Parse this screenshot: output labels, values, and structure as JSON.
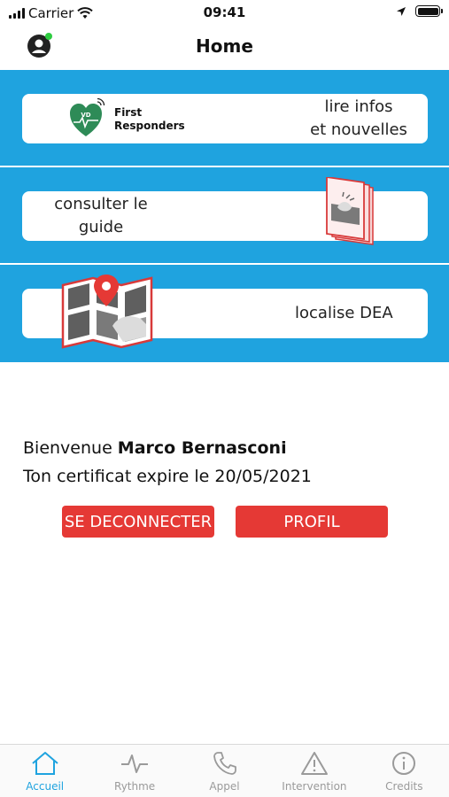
{
  "status_bar": {
    "carrier": "Carrier",
    "time": "09:41"
  },
  "nav": {
    "title": "Home"
  },
  "menu": {
    "news": {
      "logo_badge": "VD",
      "logo_line1": "First",
      "logo_line2": "Responders",
      "label_line1": "lire infos",
      "label_line2": "et nouvelles"
    },
    "guide": {
      "label_line1": "consulter le",
      "label_line2": "guide"
    },
    "dea": {
      "label": "localise DEA"
    }
  },
  "welcome": {
    "prefix": "Bienvenue ",
    "name": "Marco Bernasconi",
    "certificate": "Ton certificat expire le 20/05/2021"
  },
  "buttons": {
    "logout": "SE DECONNECTER",
    "profile": "PROFIL"
  },
  "tabs": [
    {
      "label": "Accueil",
      "icon": "home-icon",
      "active": true
    },
    {
      "label": "Rythme",
      "icon": "pulse-icon"
    },
    {
      "label": "Appel",
      "icon": "phone-icon"
    },
    {
      "label": "Intervention",
      "icon": "warning-icon"
    },
    {
      "label": "Credits",
      "icon": "info-icon"
    }
  ],
  "colors": {
    "accent": "#1fa3df",
    "button": "#e53935",
    "logo_green": "#2e8b57",
    "online": "#2ecc40"
  }
}
